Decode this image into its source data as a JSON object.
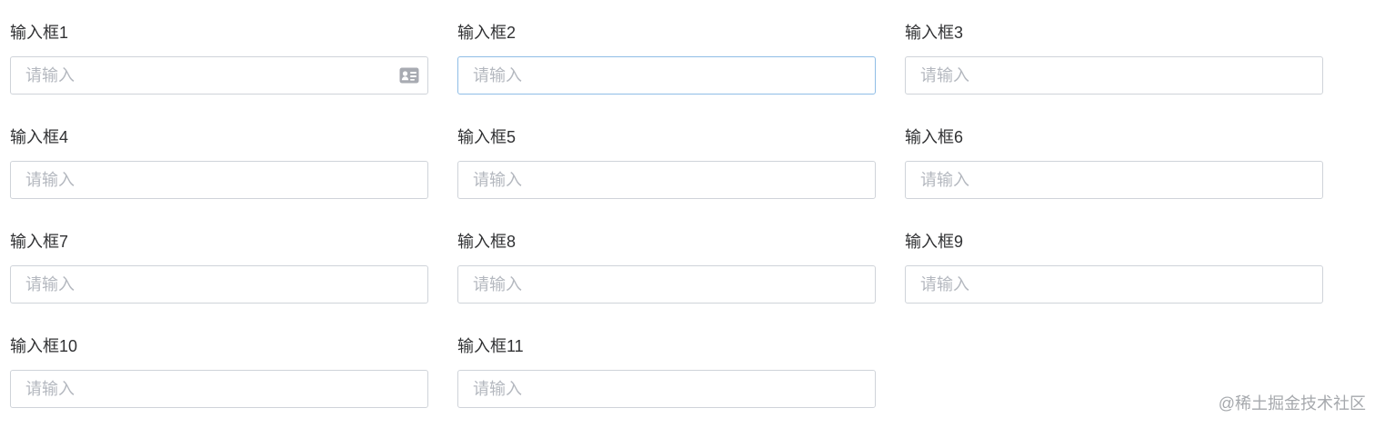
{
  "form": {
    "fields": [
      {
        "label": "输入框1",
        "placeholder": "请输入"
      },
      {
        "label": "输入框2",
        "placeholder": "请输入"
      },
      {
        "label": "输入框3",
        "placeholder": "请输入"
      },
      {
        "label": "输入框4",
        "placeholder": "请输入"
      },
      {
        "label": "输入框5",
        "placeholder": "请输入"
      },
      {
        "label": "输入框6",
        "placeholder": "请输入"
      },
      {
        "label": "输入框7",
        "placeholder": "请输入"
      },
      {
        "label": "输入框8",
        "placeholder": "请输入"
      },
      {
        "label": "输入框9",
        "placeholder": "请输入"
      },
      {
        "label": "输入框10",
        "placeholder": "请输入"
      },
      {
        "label": "输入框11",
        "placeholder": "请输入"
      }
    ],
    "field1_suffix_icon": "id-card-icon",
    "focused_field": "输入框2"
  },
  "colors": {
    "input_border": "#cfd3d9",
    "input_focus_border": "#8fbde6",
    "placeholder": "#b4b8bf",
    "label": "#303133",
    "icon": "#a8abb2"
  },
  "watermark": "@稀土掘金技术社区"
}
